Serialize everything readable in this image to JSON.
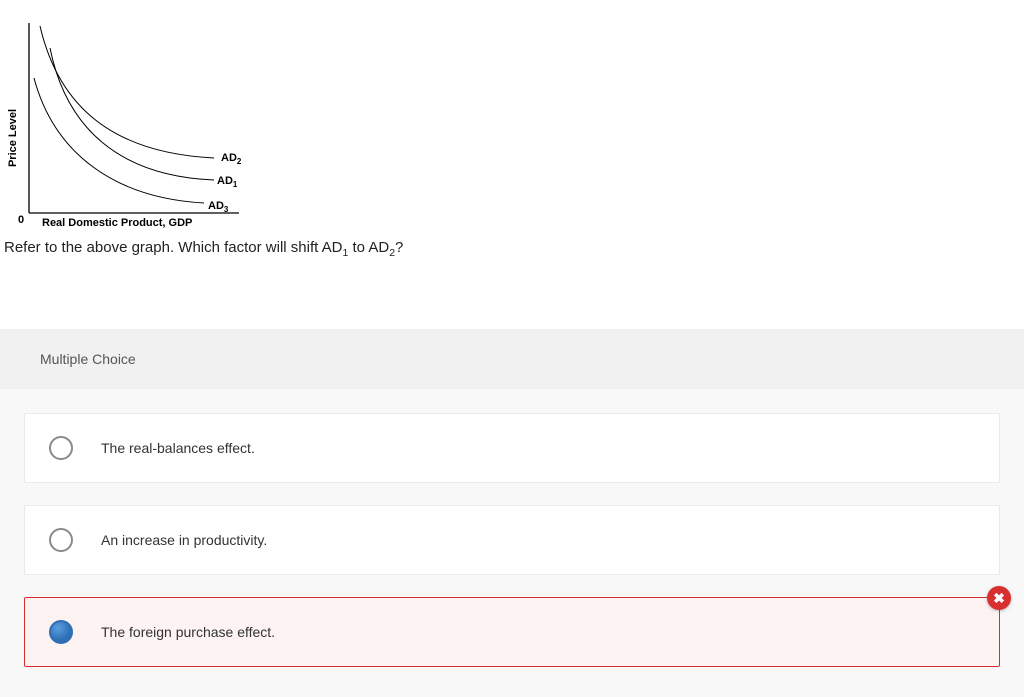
{
  "chart_data": {
    "type": "line",
    "title": "",
    "xlabel": "Real Domestic Product, GDP",
    "ylabel": "Price Level",
    "origin_label": "0",
    "series": [
      {
        "name": "AD2",
        "curve": "decreasing convex, outermost"
      },
      {
        "name": "AD1",
        "curve": "decreasing convex, middle"
      },
      {
        "name": "AD3",
        "curve": "decreasing convex, innermost"
      }
    ],
    "curve_labels": {
      "ad2": "AD",
      "ad2_sub": "2",
      "ad1": "AD",
      "ad1_sub": "1",
      "ad3": "AD",
      "ad3_sub": "3"
    }
  },
  "question": {
    "prefix": "Refer to the above graph. Which factor will shift AD",
    "sub1": "1",
    "mid": " to AD",
    "sub2": "2",
    "suffix": "?"
  },
  "mc": {
    "header": "Multiple Choice",
    "options": [
      {
        "label": "The real-balances effect."
      },
      {
        "label": "An increase in productivity."
      },
      {
        "label": "The foreign purchase effect."
      }
    ],
    "selected_index": 2,
    "selected_correct": false,
    "badge_glyph": "✖"
  }
}
